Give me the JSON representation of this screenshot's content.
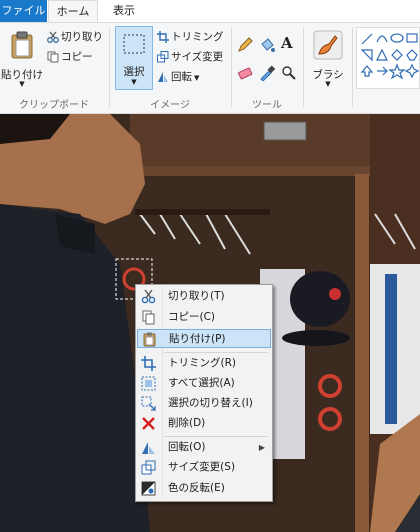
{
  "tabs": {
    "file": "ファイル",
    "home": "ホーム",
    "view": "表示"
  },
  "ribbon": {
    "clipboard": {
      "paste": "貼り付け",
      "cut": "切り取り",
      "copy": "コピー",
      "label": "クリップボード"
    },
    "image": {
      "select": "選択",
      "crop": "トリミング",
      "resize": "サイズ変更",
      "rotate": "回転",
      "label": "イメージ"
    },
    "tools": {
      "label": "ツール"
    },
    "brush": {
      "label": "ブラシ"
    }
  },
  "context_menu": {
    "items": [
      {
        "label": "切り取り(T)",
        "icon": "scissors-icon"
      },
      {
        "label": "コピー(C)",
        "icon": "copy-icon"
      },
      {
        "label": "貼り付け(P)",
        "icon": "paste-icon",
        "highlighted": true
      },
      {
        "label": "トリミング(R)",
        "icon": "crop-icon"
      },
      {
        "label": "すべて選択(A)",
        "icon": "select-all-icon"
      },
      {
        "label": "選択の切り替え(I)",
        "icon": "invert-selection-icon"
      },
      {
        "label": "削除(D)",
        "icon": "delete-x-icon"
      },
      {
        "label": "回転(O)",
        "icon": "rotate-icon",
        "submenu": true
      },
      {
        "label": "サイズ変更(S)",
        "icon": "resize-icon"
      },
      {
        "label": "色の反転(E)",
        "icon": "invert-color-icon"
      }
    ]
  },
  "colors": {
    "file_tab": "#1979ca",
    "highlight": "#cce4f7",
    "ribbon_bg": "#f5f6f7",
    "delete_red": "#d42020"
  }
}
